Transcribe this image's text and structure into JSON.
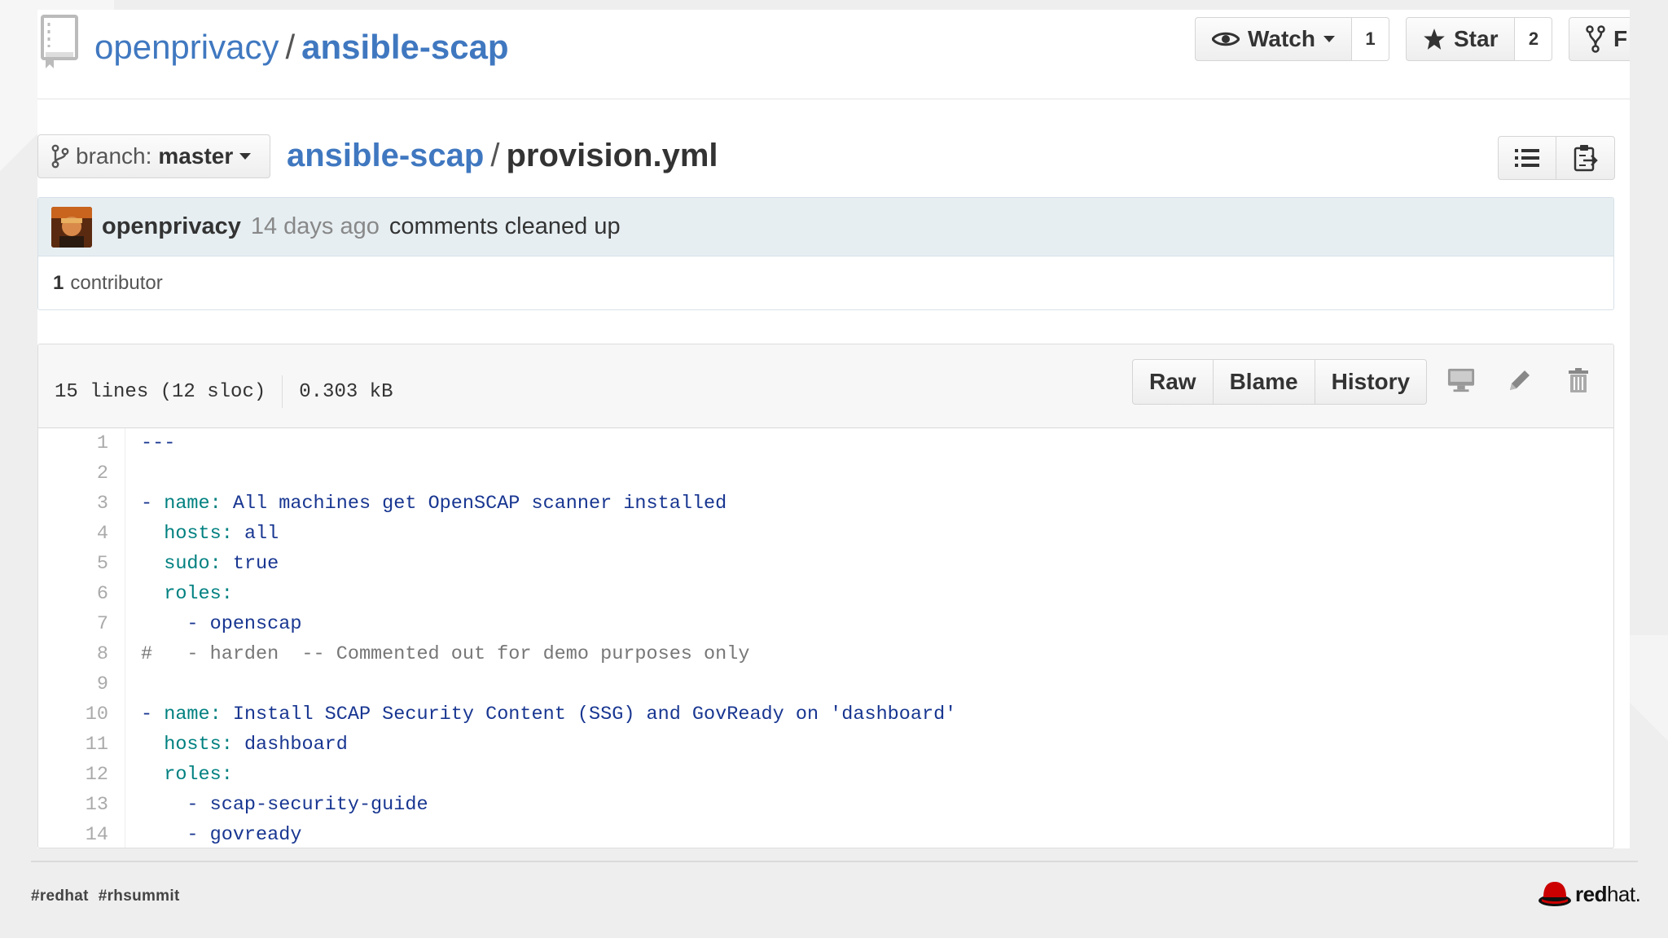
{
  "repo": {
    "owner": "openprivacy",
    "separator": "/",
    "name": "ansible-scap",
    "watch_label": "Watch",
    "watch_count": "1",
    "star_label": "Star",
    "star_count": "2",
    "fork_label": "F"
  },
  "file_nav": {
    "branch_prefix": "branch:",
    "branch_name": "master",
    "crumb_repo": "ansible-scap",
    "crumb_sep": "/",
    "crumb_file": "provision.yml"
  },
  "commit": {
    "author": "openprivacy",
    "age": "14 days ago",
    "message": "comments cleaned up",
    "contributor_count": "1",
    "contributor_label": "contributor"
  },
  "file": {
    "lines_info": "15 lines (12 sloc)",
    "size": "0.303 kB",
    "raw_label": "Raw",
    "blame_label": "Blame",
    "history_label": "History"
  },
  "code_lines": [
    {
      "n": "1",
      "t": "---"
    },
    {
      "n": "2",
      "t": ""
    },
    {
      "n": "3",
      "t": "- name: All machines get OpenSCAP scanner installed"
    },
    {
      "n": "4",
      "t": "  hosts: all"
    },
    {
      "n": "5",
      "t": "  sudo: true"
    },
    {
      "n": "6",
      "t": "  roles:"
    },
    {
      "n": "7",
      "t": "    - openscap"
    },
    {
      "n": "8",
      "t": "#   - harden  -- Commented out for demo purposes only"
    },
    {
      "n": "9",
      "t": ""
    },
    {
      "n": "10",
      "t": "- name: Install SCAP Security Content (SSG) and GovReady on 'dashboard'"
    },
    {
      "n": "11",
      "t": "  hosts: dashboard"
    },
    {
      "n": "12",
      "t": "  roles:"
    },
    {
      "n": "13",
      "t": "    - scap-security-guide"
    },
    {
      "n": "14",
      "t": "    - govready"
    }
  ],
  "footer": {
    "tag1": "#redhat",
    "tag2": "#rhsummit",
    "logo_bold": "red",
    "logo_light": "hat."
  },
  "colors": {
    "link": "#4078c0",
    "yaml_key": "#008080",
    "yaml_value": "#183691",
    "commit_bg": "#e6eef2"
  }
}
